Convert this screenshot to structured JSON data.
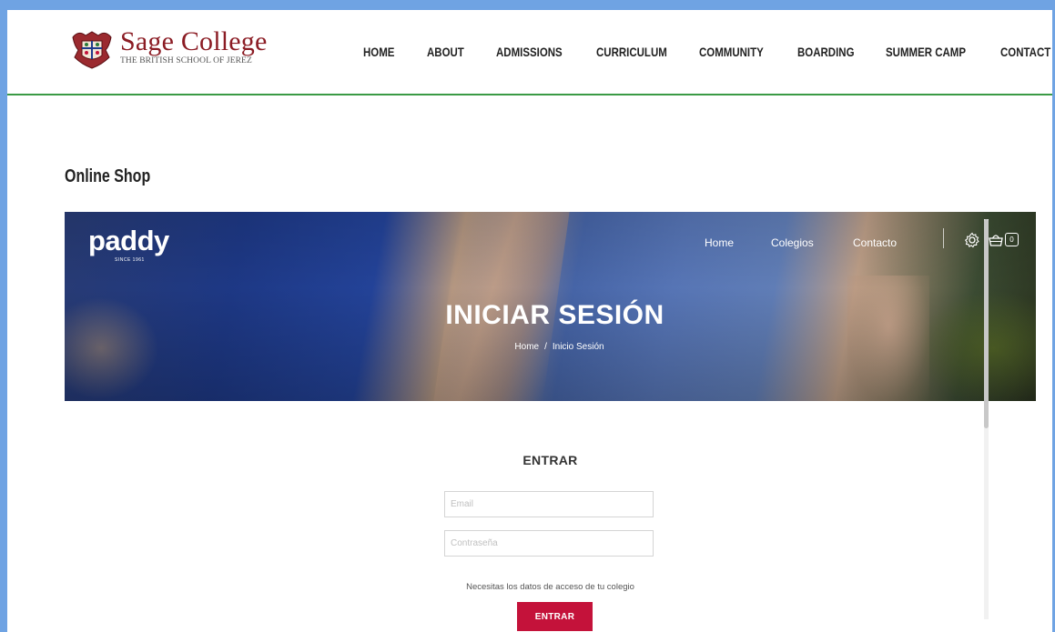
{
  "site": {
    "logo_title": "Sage College",
    "logo_subtitle": "THE BRITISH SCHOOL OF JEREZ",
    "nav": [
      "HOME",
      "ABOUT",
      "ADMISSIONS",
      "CURRICULUM",
      "COMMUNITY",
      "BOARDING",
      "SUMMER CAMP",
      "CONTACT"
    ],
    "accent_color": "#3a9a45",
    "brand_color": "#8b1c24"
  },
  "page_title": "Online Shop",
  "shop": {
    "logo": "paddy",
    "logo_tag": "SINCE 1961",
    "nav": [
      "Home",
      "Colegios",
      "Contacto"
    ],
    "icons": [
      "settings-icon",
      "basket-icon",
      "cart-count-icon"
    ],
    "cart_count": "0",
    "hero_title": "INICIAR SESIÓN",
    "breadcrumb": {
      "home": "Home",
      "separator": "/",
      "current": "Inicio Sesión"
    },
    "login": {
      "title": "ENTRAR",
      "email_placeholder": "Email",
      "password_placeholder": "Contraseña",
      "hint": "Necesitas los datos de acceso de tu colegio",
      "button": "ENTRAR",
      "button_color": "#c4123a"
    }
  }
}
